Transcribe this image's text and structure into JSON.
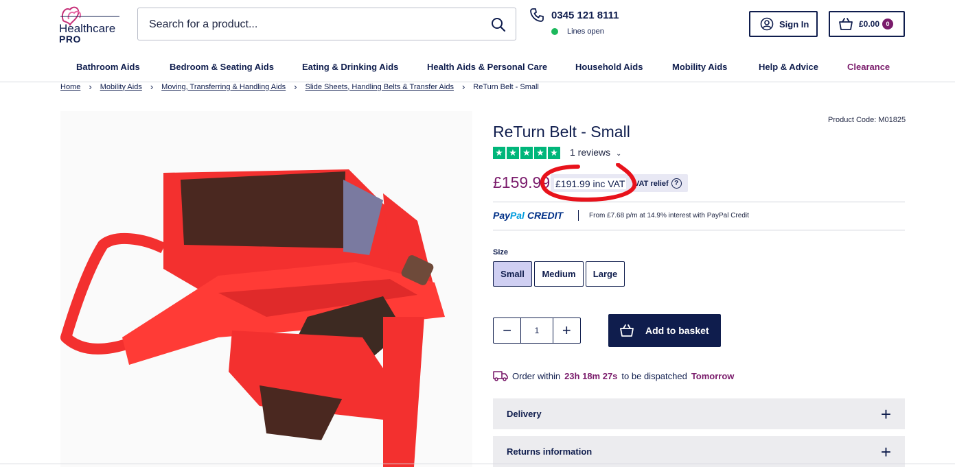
{
  "header": {
    "logo_text": "Healthcare",
    "logo_pro": "PRO",
    "search_placeholder": "Search for a product...",
    "phone": "0345 121 8111",
    "phone_status": "Lines open",
    "signin_label": "Sign In",
    "basket_total": "£0.00",
    "basket_count": "0"
  },
  "nav": {
    "items": [
      "Bathroom Aids",
      "Bedroom & Seating Aids",
      "Eating & Drinking Aids",
      "Health Aids & Personal Care",
      "Household Aids",
      "Mobility Aids",
      "Help & Advice",
      "Clearance"
    ]
  },
  "breadcrumb": [
    "Home",
    "Mobility Aids",
    "Moving, Transferring & Handling Aids",
    "Slide Sheets, Handling Belts & Transfer Aids",
    "ReTurn Belt - Small"
  ],
  "product": {
    "code": "Product Code: M01825",
    "title": "ReTurn Belt - Small",
    "reviews": "1 reviews",
    "rating_stars": 5,
    "price_ex": "£159.99",
    "price_inc": "£191.99 inc VAT",
    "vat_relief": "VAT relief",
    "paypal_credit_text": "From £7.68 p/m at 14.9% interest with PayPal Credit",
    "paypal_pay": "Pay",
    "paypal_pal": "Pal",
    "paypal_credit": "CREDIT",
    "size_label": "Size",
    "sizes": [
      "Small",
      "Medium",
      "Large"
    ],
    "selected_size": "Small",
    "quantity": "1",
    "add_to_basket": "Add to basket",
    "dispatch_prefix": "Order within",
    "dispatch_time": "23h 18m 27s",
    "dispatch_mid": "to be dispatched",
    "dispatch_day": "Tomorrow"
  },
  "accordions": [
    "Delivery",
    "Returns information"
  ],
  "colors": {
    "navy": "#0f1d4d",
    "plum": "#7a1b6b",
    "trustpilot_green": "#00b67a",
    "annotation_red": "#e8121b",
    "lines_open_green": "#1cb85c"
  }
}
